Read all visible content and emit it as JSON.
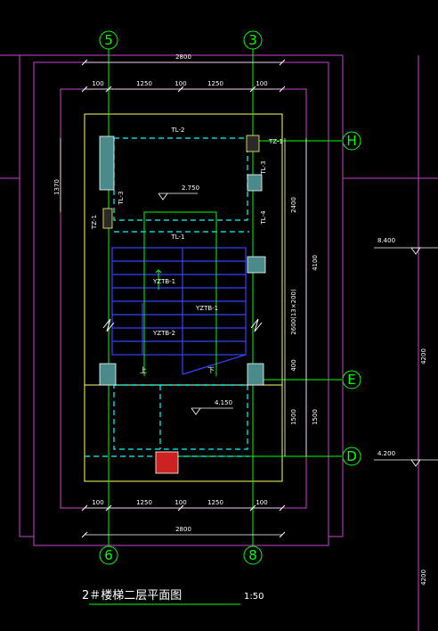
{
  "drawing_title": "2＃楼梯二层平面图",
  "scale": "1:50",
  "axes": {
    "top": [
      "5",
      "3"
    ],
    "bottom": [
      "6",
      "8"
    ],
    "right": [
      "H",
      "E",
      "D"
    ]
  },
  "dims": {
    "top_total": "2800",
    "top_parts": [
      "100",
      "1250",
      "100",
      "1250",
      "100"
    ],
    "bottom_total": "2800",
    "bottom_parts": [
      "100",
      "1250",
      "100",
      "1250",
      "100"
    ],
    "right_parts": [
      "2400",
      "4100",
      "2600(13×200)",
      "400",
      "1500"
    ],
    "right_single": "1500",
    "left_vertical": "1370"
  },
  "labels": {
    "tl2": "TL-2",
    "tz1_top": "TZ-1",
    "tz1_left": "TZ-1",
    "tl3_left": "TL-3",
    "tl3_right": "TL-3",
    "tl4": "TL-4",
    "tl1": "TL-1",
    "ytb1_a": "YZTB-1",
    "ytb1_b": "YZTB-1",
    "ytb2": "YZTB-2",
    "up": "上",
    "down": "下",
    "elev_landing": "2.750",
    "elev_floor": "4.150",
    "elev_right_1": "8.400",
    "elev_right_2": "4.200",
    "dim_right_far_1": "4200",
    "dim_right_far_2": "4200"
  },
  "colors": {
    "background": "#000000",
    "axis_green": "#00ff00",
    "wall_yellow": "#ffff66",
    "beam_cyan": "#00ffff",
    "stair_blue": "#3344ff",
    "grid_magenta": "#cc44cc",
    "column_teal": "#4a8a8a",
    "column_red": "#cc2222",
    "text_white": "#ffffff"
  }
}
